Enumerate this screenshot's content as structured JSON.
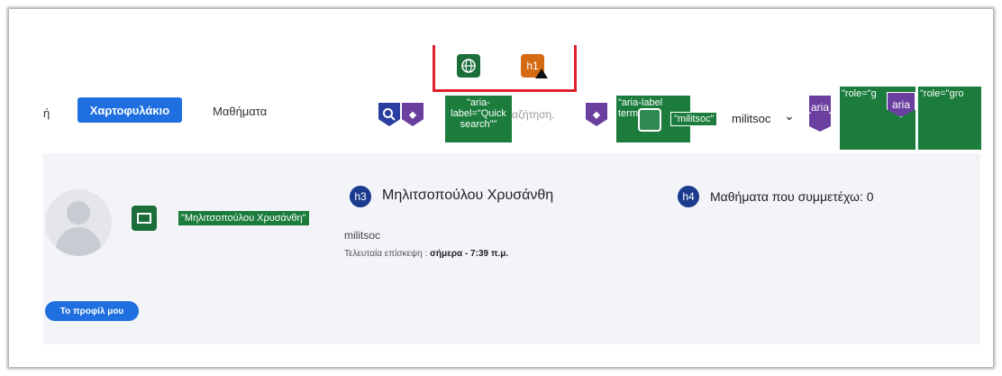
{
  "overlay": {
    "globe_icon": "globe-icon",
    "h1_badge": "h1",
    "aria_quicksearch": "\"aria-label=\"Quick search\"\"",
    "search_placeholder_tail": "αζήτηση.",
    "aria_terms": "\"aria-label terms",
    "militsoc_label": "\"militsoc\"",
    "aria_badge_1": "aria",
    "aria_badge_2": "aria",
    "role_label_1": "\"role=\"g",
    "role_label_2": "\"role=\"gro"
  },
  "nav": {
    "partial_item": "ή",
    "tabs": [
      {
        "label": "Χαρτοφυλάκιο",
        "active": true
      },
      {
        "label": "Μαθήματα",
        "active": false
      }
    ],
    "username": "militsoc"
  },
  "profile": {
    "alt_label": "\"Μηλιτσοπούλου Χρυσάνθη\"",
    "heading_level": "h3",
    "full_name": "Μηλιτσοπούλου Χρυσάνθη",
    "username": "militsoc",
    "last_visit_label": "Τελευταία επίσκεψη :",
    "last_visit_value": "σήμερα - 7:39 π.μ.",
    "courses_heading_level": "h4",
    "courses_text": "Μαθήματα που συμμετέχω: 0",
    "profile_button": "Το προφίλ μου"
  },
  "colors": {
    "accent": "#1f6fe0",
    "overlay_green": "#1b7c3c",
    "overlay_red": "#e0202a",
    "heading_badge": "#1c3a8e"
  }
}
